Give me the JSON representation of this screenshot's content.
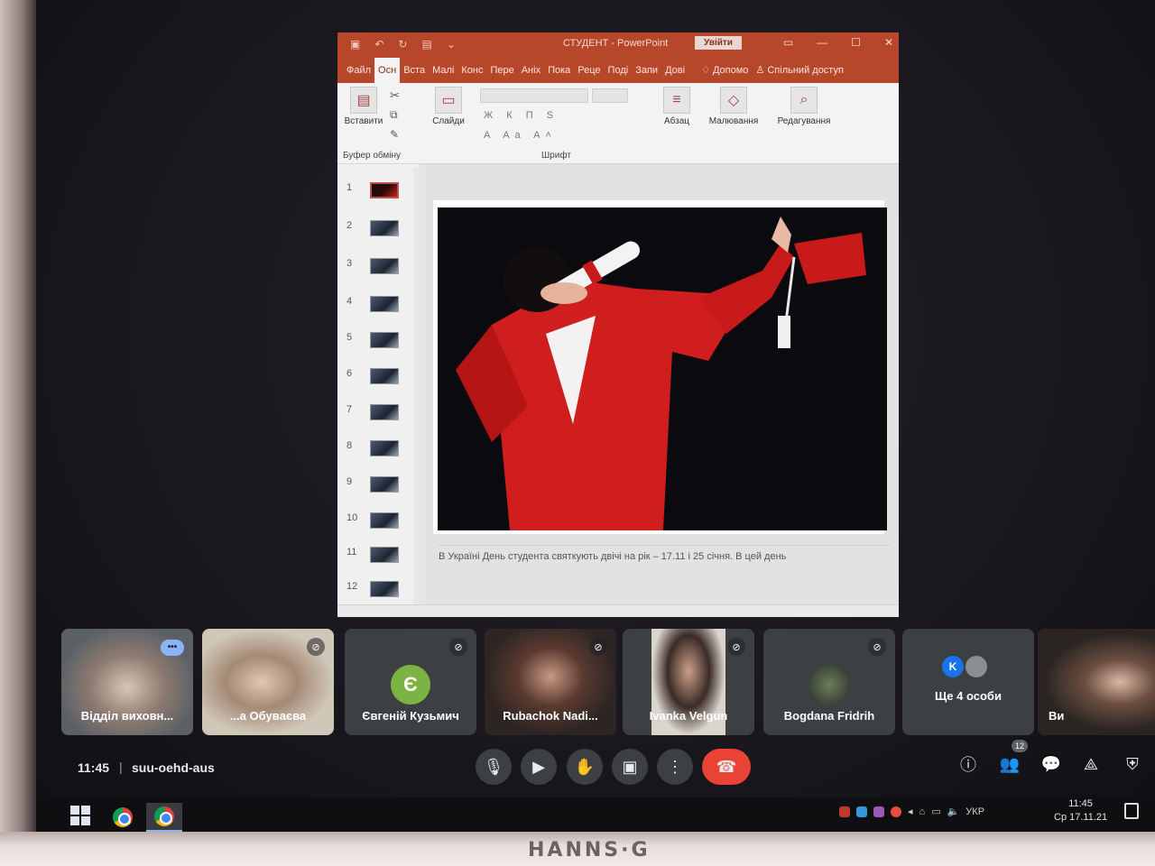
{
  "ppt": {
    "doc_title": "СТУДЕНТ - PowerPoint",
    "signin": "Увійти",
    "tabs": [
      "Файл",
      "Осн",
      "Вста",
      "Малі",
      "Конс",
      "Пере",
      "Аніх",
      "Пока",
      "Реце",
      "Поді",
      "Запи",
      "Дові"
    ],
    "help": "Допомо",
    "share": "Спільний доступ",
    "ribbon": {
      "paste": "Вставити",
      "clipboard": "Буфер обміну",
      "slides": "Слайди",
      "font": "Шрифт",
      "paragraph": "Абзац",
      "drawing": "Малювання",
      "editing": "Редагування",
      "bold": "Ж",
      "italic": "К",
      "underline": "П",
      "strike": "S",
      "case": "Aa"
    },
    "thumbnails": [
      "1",
      "2",
      "3",
      "4",
      "5",
      "6",
      "7",
      "8",
      "9",
      "10",
      "11",
      "12"
    ],
    "notes_text": "В Україні День студента святкують двічі на рік – 17.11  і 25 січня. В цей день"
  },
  "meet": {
    "participants": [
      {
        "name": "Відділ виховн...",
        "kind": "video"
      },
      {
        "name": "...а Обувaєва",
        "kind": "video"
      },
      {
        "name": "Євгеній Кузьмич",
        "kind": "avatar",
        "initial": "Є",
        "color": "#7cb342"
      },
      {
        "name": "Rubachok Nadi...",
        "kind": "video"
      },
      {
        "name": "Ivanka Velgun",
        "kind": "video"
      },
      {
        "name": "Bogdana Fridrih",
        "kind": "photo"
      },
      {
        "name": "Ще 4 особи",
        "kind": "group",
        "initial": "K"
      },
      {
        "name": "Ви",
        "kind": "video"
      }
    ],
    "time": "11:45",
    "meeting_code": "suu-oehd-aus",
    "participant_count": "12"
  },
  "taskbar": {
    "lang": "УКР",
    "time": "11:45",
    "date": "Ср 17.11.21"
  },
  "monitor_brand": "HANNS·G",
  "colors": {
    "ppt_accent": "#b7472a",
    "meet_end": "#ea4335",
    "tile_bg": "#3c4043"
  }
}
